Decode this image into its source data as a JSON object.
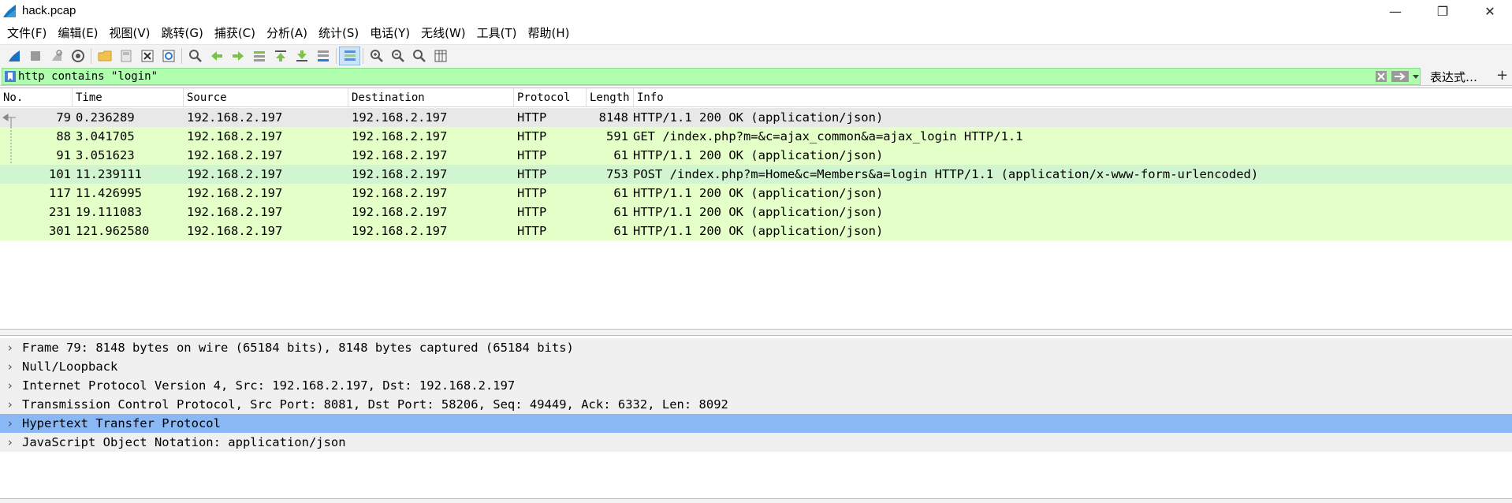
{
  "window": {
    "title": "hack.pcap",
    "minimize_glyph": "—",
    "restore_glyph": "❐",
    "close_glyph": "✕"
  },
  "menu": {
    "items": [
      "文件(F)",
      "编辑(E)",
      "视图(V)",
      "跳转(G)",
      "捕获(C)",
      "分析(A)",
      "统计(S)",
      "电话(Y)",
      "无线(W)",
      "工具(T)",
      "帮助(H)"
    ]
  },
  "toolbar": {
    "icons": [
      "start-capture-icon",
      "stop-capture-icon",
      "restart-capture-icon",
      "capture-options-icon",
      "open-file-icon",
      "save-file-icon",
      "close-file-icon",
      "reload-file-icon",
      "find-packet-icon",
      "go-back-icon",
      "go-forward-icon",
      "go-to-packet-icon",
      "go-first-icon",
      "go-last-icon",
      "auto-scroll-icon",
      "colorize-icon",
      "zoom-in-icon",
      "zoom-out-icon",
      "normal-size-icon",
      "resize-columns-icon"
    ]
  },
  "filter": {
    "value": "http contains \"login\"",
    "expression_label": "表达式…",
    "add_label": "+",
    "color_valid": "#afffaf"
  },
  "packet_list": {
    "columns": [
      "No.",
      "Time",
      "Source",
      "Destination",
      "Protocol",
      "Length",
      "Info"
    ],
    "rows": [
      {
        "no": "79",
        "time": "0.236289",
        "src": "192.168.2.197",
        "dst": "192.168.2.197",
        "proto": "HTTP",
        "len": "8148",
        "info": "HTTP/1.1 200 OK  (application/json)",
        "selected": true
      },
      {
        "no": "88",
        "time": "3.041705",
        "src": "192.168.2.197",
        "dst": "192.168.2.197",
        "proto": "HTTP",
        "len": "591",
        "info": "GET /index.php?m=&c=ajax_common&a=ajax_login HTTP/1.1"
      },
      {
        "no": "91",
        "time": "3.051623",
        "src": "192.168.2.197",
        "dst": "192.168.2.197",
        "proto": "HTTP",
        "len": "61",
        "info": "HTTP/1.1 200 OK  (application/json)"
      },
      {
        "no": "101",
        "time": "11.239111",
        "src": "192.168.2.197",
        "dst": "192.168.2.197",
        "proto": "HTTP",
        "len": "753",
        "info": "POST /index.php?m=Home&c=Members&a=login HTTP/1.1  (application/x-www-form-urlencoded)"
      },
      {
        "no": "117",
        "time": "11.426995",
        "src": "192.168.2.197",
        "dst": "192.168.2.197",
        "proto": "HTTP",
        "len": "61",
        "info": "HTTP/1.1 200 OK  (application/json)"
      },
      {
        "no": "231",
        "time": "19.111083",
        "src": "192.168.2.197",
        "dst": "192.168.2.197",
        "proto": "HTTP",
        "len": "61",
        "info": "HTTP/1.1 200 OK  (application/json)"
      },
      {
        "no": "301",
        "time": "121.962580",
        "src": "192.168.2.197",
        "dst": "192.168.2.197",
        "proto": "HTTP",
        "len": "61",
        "info": "HTTP/1.1 200 OK  (application/json)"
      }
    ],
    "colors": {
      "http_row": "#e4ffc7",
      "selected_row": "#e8e8e8",
      "hover_row": "#d0f5d0"
    }
  },
  "details": {
    "rows": [
      {
        "text": "Frame 79: 8148 bytes on wire (65184 bits), 8148 bytes captured (65184 bits)"
      },
      {
        "text": "Null/Loopback"
      },
      {
        "text": "Internet Protocol Version 4, Src: 192.168.2.197, Dst: 192.168.2.197"
      },
      {
        "text": "Transmission Control Protocol, Src Port: 8081, Dst Port: 58206, Seq: 49449, Ack: 6332, Len: 8092"
      },
      {
        "text": "Hypertext Transfer Protocol",
        "selected": true
      },
      {
        "text": "JavaScript Object Notation: application/json"
      }
    ],
    "arrow_glyph": "›",
    "selected_color": "#8ab8f5"
  }
}
